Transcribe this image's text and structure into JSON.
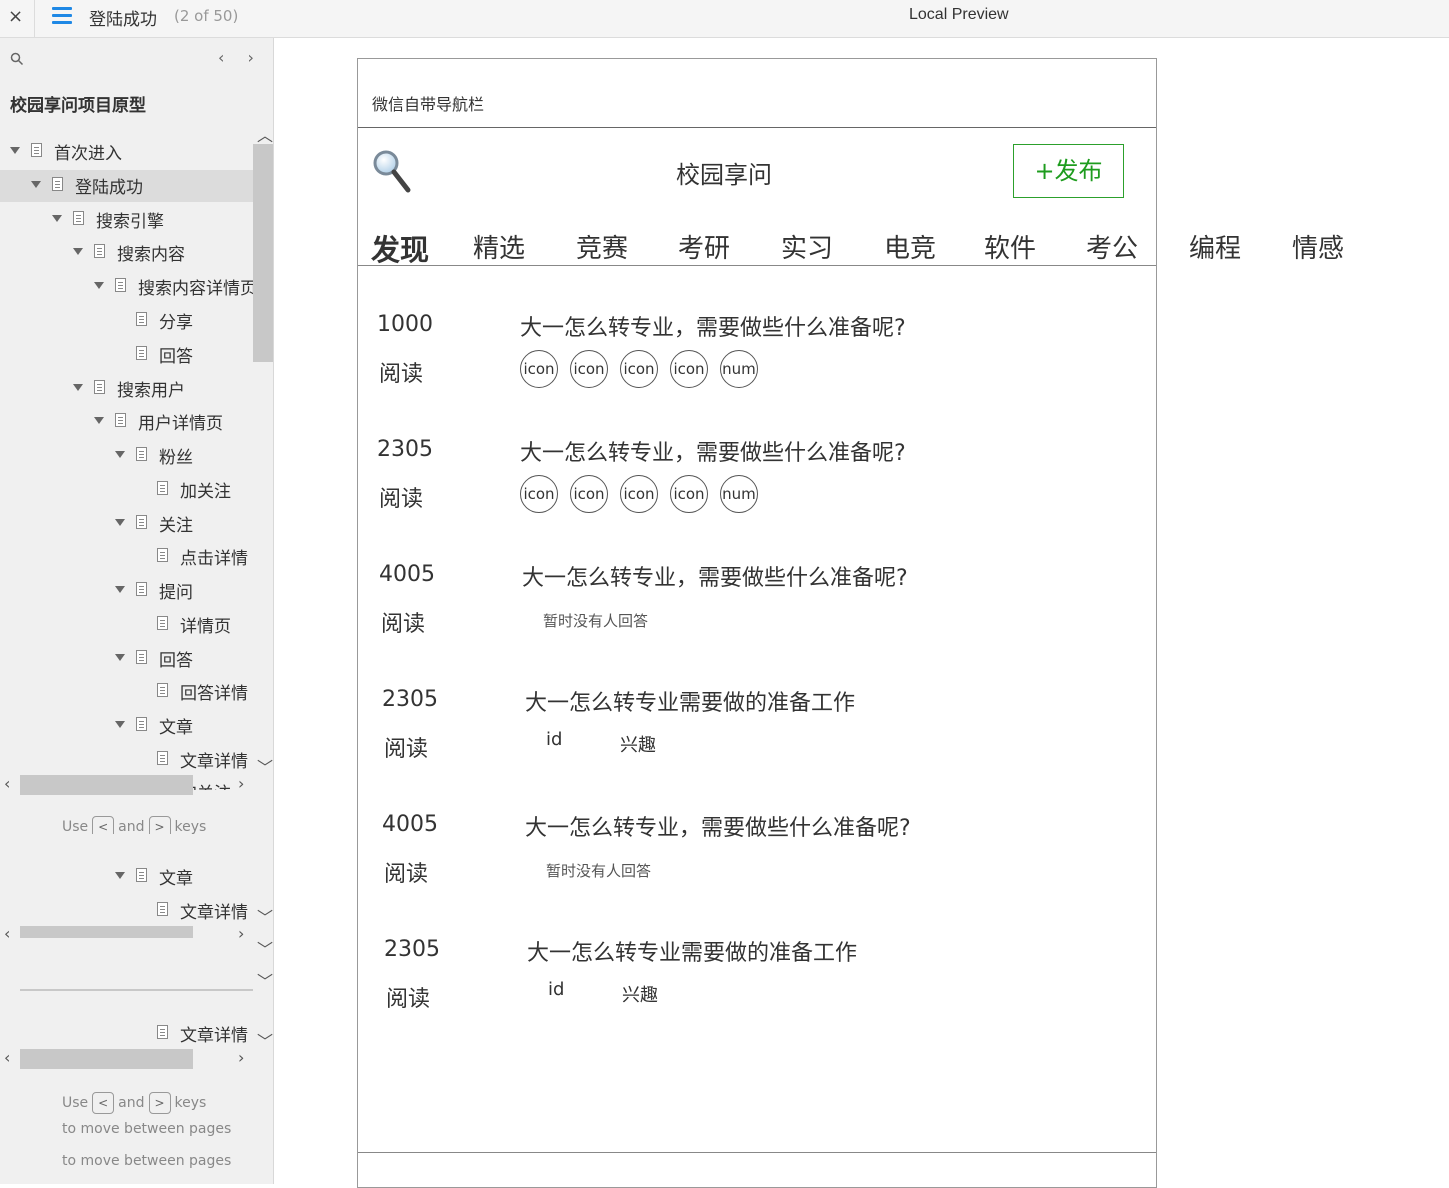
{
  "topbar": {
    "close": "×",
    "title": "登陆成功",
    "page_count": "(2 of 50)",
    "preview_title": "Local Preview"
  },
  "sidebar": {
    "search_icon": "🔍",
    "prev": "‹",
    "next": "›",
    "project": "校园享问项目原型",
    "items": [
      {
        "label": "首次进入"
      },
      {
        "label": "登陆成功"
      },
      {
        "label": "搜索引擎"
      },
      {
        "label": "搜索内容"
      },
      {
        "label": "搜索内容详情页"
      },
      {
        "label": "分享"
      },
      {
        "label": "回答"
      },
      {
        "label": "搜索用户"
      },
      {
        "label": "用户详情页"
      },
      {
        "label": "粉丝"
      },
      {
        "label": "加关注"
      },
      {
        "label": "关注"
      },
      {
        "label": "点击详情"
      },
      {
        "label": "提问"
      },
      {
        "label": "详情页"
      },
      {
        "label": "回答"
      },
      {
        "label": "回答详情"
      },
      {
        "label": "文章"
      },
      {
        "label": "文章详情"
      },
      {
        "label": "加关注"
      },
      {
        "label": "文章"
      },
      {
        "label": "文章详情"
      },
      {
        "label": "文章详情"
      }
    ],
    "hint_use": "Use",
    "hint_and": "and",
    "hint_keys": "keys",
    "hint_move": "to move between pages",
    "hint_move2": "to move between pages",
    "key_prev": "<",
    "key_next": ">"
  },
  "phone": {
    "wx_bar": "微信自带导航栏",
    "app_title": "校园享问",
    "publish": "+发布",
    "tabs": [
      "发现",
      "精选",
      "竞赛",
      "考研",
      "实习",
      "电竞",
      "软件",
      "考公",
      "编程",
      "情感"
    ],
    "read_label": "阅读",
    "posts": [
      {
        "count": "1000",
        "question": "大一怎么转专业，需要做些什么准备呢?",
        "circles": [
          "icon",
          "icon",
          "icon",
          "icon",
          "num"
        ]
      },
      {
        "count": "2305",
        "question": "大一怎么转专业，需要做些什么准备呢?",
        "circles": [
          "icon",
          "icon",
          "icon",
          "icon",
          "num"
        ]
      },
      {
        "count": "4005",
        "question": "大一怎么转专业，需要做些什么准备呢?",
        "no_answer": "暂时没有人回答"
      },
      {
        "count": "2305",
        "question": "大一怎么转专业需要做的准备工作",
        "id": "id",
        "tag": "兴趣"
      },
      {
        "count": "4005",
        "question": "大一怎么转专业，需要做些什么准备呢?",
        "no_answer": "暂时没有人回答"
      },
      {
        "count": "2305",
        "question": "大一怎么转专业需要做的准备工作",
        "id": "id",
        "tag": "兴趣"
      }
    ]
  }
}
